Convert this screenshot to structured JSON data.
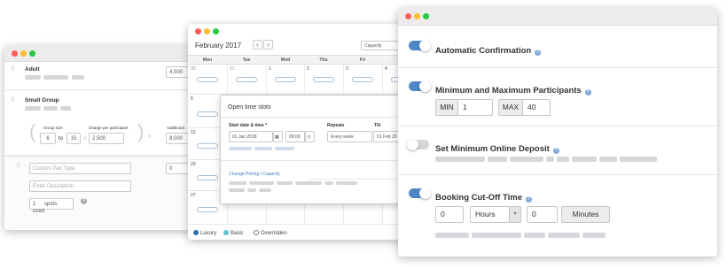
{
  "pax_window": {
    "adult": {
      "title": "Adult",
      "price": "4,000"
    },
    "small_group": {
      "title": "Small Group",
      "group_size_label": "Group size",
      "group_min": "6",
      "group_to": "to",
      "group_max": "15",
      "charge_label": "Charge per participant",
      "charge_value": "2,500",
      "additional_label": "Additional",
      "additional_value": "8,000"
    },
    "custom": {
      "type_placeholder": "Custom Pax Type",
      "count_value": "0",
      "description_placeholder": "Enter Description",
      "spots_value": "1",
      "spots_label": "spots used"
    }
  },
  "calendar_window": {
    "month_title": "February 2017",
    "prev_arrow": "‹",
    "next_arrow": "›",
    "view_select": "Capacity",
    "days": [
      "Mon",
      "Tue",
      "Wed",
      "Thu",
      "Fri"
    ],
    "row1_dates": [
      "30",
      "31",
      "1",
      "2",
      "3",
      "4"
    ],
    "row_start_dates": [
      "6",
      "13",
      "20",
      "27"
    ],
    "popup": {
      "title": "Open time slots",
      "start_label": "Start date & time *",
      "start_date": "01 Jan 2018",
      "start_time": "09:00",
      "repeats_label": "Repeats",
      "repeats_value": "Every week",
      "till_label": "Till",
      "till_value": "01 Feb 20",
      "change_link": "Change Pricing / Capacity"
    },
    "legend": [
      {
        "label": "Luxury",
        "color": "#2f6fb5"
      },
      {
        "label": "Basic",
        "color": "#5fc3c9"
      },
      {
        "label": "Overridden",
        "color": "#ffffff"
      }
    ]
  },
  "settings_window": {
    "auto_confirm": {
      "title": "Automatic Confirmation",
      "enabled": true
    },
    "participants": {
      "title": "Minimum and Maximum Participants",
      "enabled": true,
      "min_label": "MIN",
      "min_value": "1",
      "separator": "–",
      "max_label": "MAX",
      "max_value": "40"
    },
    "deposit": {
      "title": "Set Minimum Online Deposit",
      "enabled": false
    },
    "cutoff": {
      "title": "Booking Cut-Off Time",
      "enabled": true,
      "hours_value": "0",
      "unit_select": "Hours",
      "minutes_value": "0",
      "minutes_label": "Minutes"
    },
    "accent_color": "#4f86c6",
    "help_icon": "question-circle-icon"
  }
}
